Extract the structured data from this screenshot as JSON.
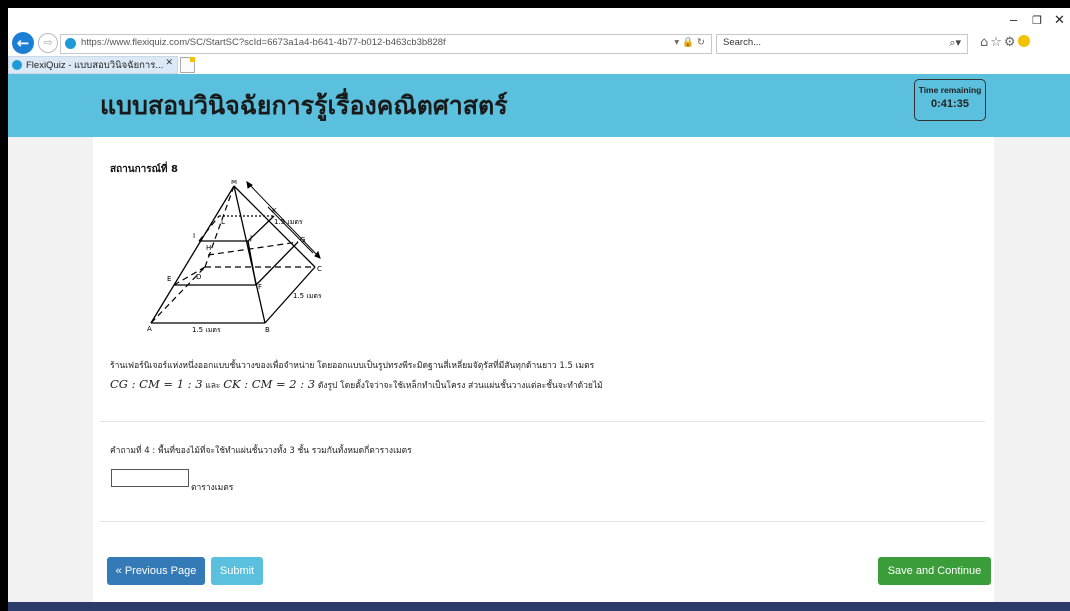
{
  "browser": {
    "url": "https://www.flexiquiz.com/SC/StartSC?scId=6673a1a4-b641-4b77-b012-b463cb3b828f",
    "url_icons": "▾ 🔒 ↻",
    "search_placeholder": "Search...",
    "tab_title": "FlexiQuiz - แบบสอบวินิจฉัยการ...",
    "window_controls": {
      "min": "–",
      "max": "❐",
      "close": "✕"
    }
  },
  "header": {
    "title": "แบบสอบวินิจฉัยการรู้เรื่องคณิตศาสตร์",
    "timer_label": "Time remaining",
    "timer_value": "0:41:35"
  },
  "scenario": {
    "heading": "สถานการณ์ที่ 8",
    "figure_labels": {
      "M": "M",
      "K": "K",
      "L": "L",
      "I": "I",
      "J": "J",
      "H": "H",
      "G": "G",
      "E": "E",
      "D": "D",
      "C": "C",
      "F": "F",
      "A": "A",
      "B": "B",
      "measure_edge": "1.5 เมตร",
      "measure_side": "1.5 เมตร",
      "measure_base": "1.5 เมตร"
    },
    "description_line1": "ร้านเฟอร์นิเจอร์แห่งหนึ่งออกแบบชั้นวางของเพื่อจำหน่าย โดยออกแบบเป็นรูปทรงพีระมิดฐานสี่เหลี่ยมจัตุรัสที่มีสันทุกด้านยาว 1.5 เมตร",
    "math_1": "CG : CM = 1 : 3",
    "and_word": "และ",
    "math_2": "CK : CM = 2 : 3",
    "description_line2_rest": "ดังรูป โดยตั้งใจว่าจะใช้เหล็กทำเป็นโครง ส่วนแผ่นชั้นวางแต่ละชั้นจะทำด้วยไม้"
  },
  "question": {
    "text": "คำถามที่ 4 : พื้นที่ของไม้ที่จะใช้ทำแผ่นชั้นวางทั้ง 3 ชั้น รวมกันทั้งหมดกี่ตารางเมตร",
    "answer_value": "",
    "unit": "ตารางเมตร"
  },
  "buttons": {
    "previous": "« Previous Page",
    "submit": "Submit",
    "save_continue": "Save and Continue"
  },
  "colors": {
    "header_bg": "#5bc0de",
    "previous_btn": "#337ab7",
    "submit_btn": "#5bc0de",
    "save_btn": "#3a9d3a",
    "footer": "#2b3b6a"
  }
}
